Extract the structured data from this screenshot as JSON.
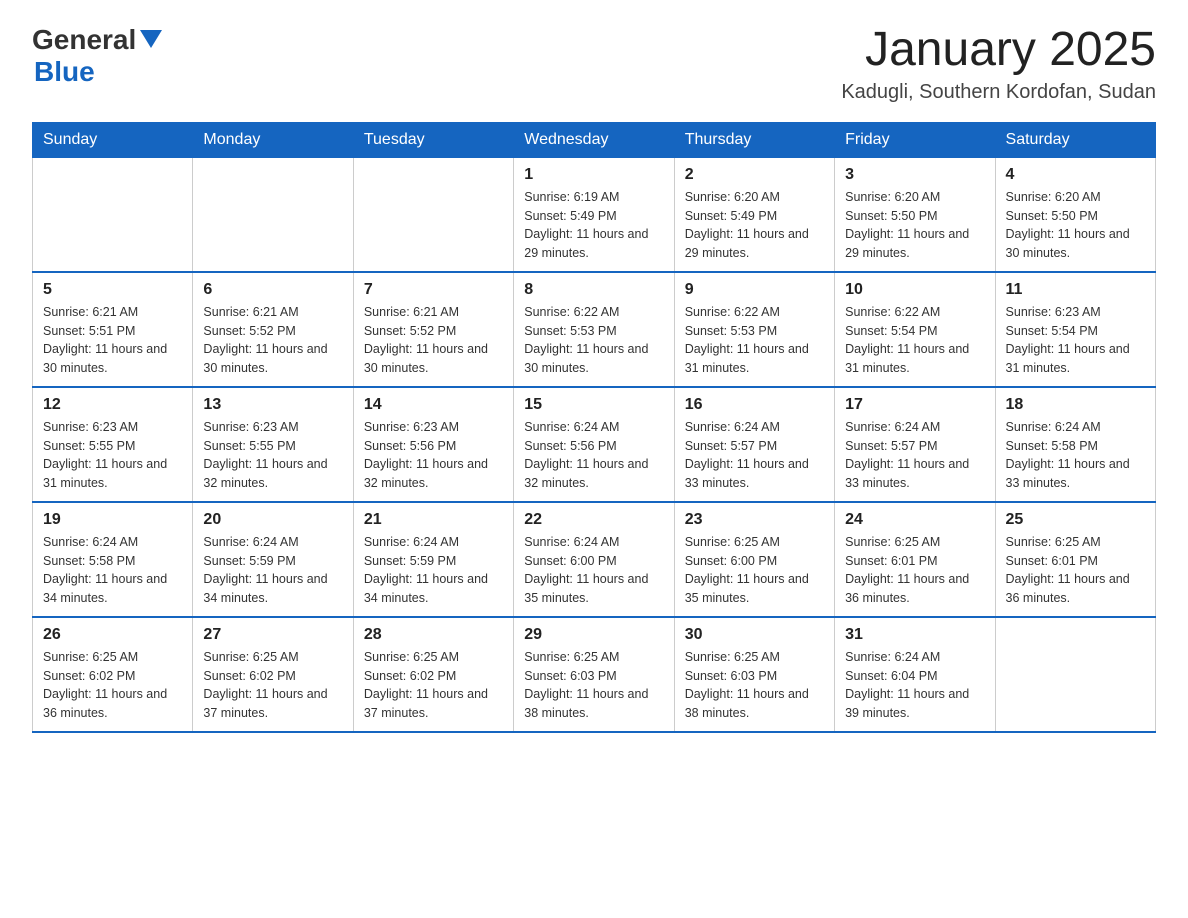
{
  "logo": {
    "general": "General",
    "blue": "Blue"
  },
  "title": "January 2025",
  "subtitle": "Kadugli, Southern Kordofan, Sudan",
  "days_of_week": [
    "Sunday",
    "Monday",
    "Tuesday",
    "Wednesday",
    "Thursday",
    "Friday",
    "Saturday"
  ],
  "weeks": [
    [
      {
        "day": "",
        "info": ""
      },
      {
        "day": "",
        "info": ""
      },
      {
        "day": "",
        "info": ""
      },
      {
        "day": "1",
        "info": "Sunrise: 6:19 AM\nSunset: 5:49 PM\nDaylight: 11 hours and 29 minutes."
      },
      {
        "day": "2",
        "info": "Sunrise: 6:20 AM\nSunset: 5:49 PM\nDaylight: 11 hours and 29 minutes."
      },
      {
        "day": "3",
        "info": "Sunrise: 6:20 AM\nSunset: 5:50 PM\nDaylight: 11 hours and 29 minutes."
      },
      {
        "day": "4",
        "info": "Sunrise: 6:20 AM\nSunset: 5:50 PM\nDaylight: 11 hours and 30 minutes."
      }
    ],
    [
      {
        "day": "5",
        "info": "Sunrise: 6:21 AM\nSunset: 5:51 PM\nDaylight: 11 hours and 30 minutes."
      },
      {
        "day": "6",
        "info": "Sunrise: 6:21 AM\nSunset: 5:52 PM\nDaylight: 11 hours and 30 minutes."
      },
      {
        "day": "7",
        "info": "Sunrise: 6:21 AM\nSunset: 5:52 PM\nDaylight: 11 hours and 30 minutes."
      },
      {
        "day": "8",
        "info": "Sunrise: 6:22 AM\nSunset: 5:53 PM\nDaylight: 11 hours and 30 minutes."
      },
      {
        "day": "9",
        "info": "Sunrise: 6:22 AM\nSunset: 5:53 PM\nDaylight: 11 hours and 31 minutes."
      },
      {
        "day": "10",
        "info": "Sunrise: 6:22 AM\nSunset: 5:54 PM\nDaylight: 11 hours and 31 minutes."
      },
      {
        "day": "11",
        "info": "Sunrise: 6:23 AM\nSunset: 5:54 PM\nDaylight: 11 hours and 31 minutes."
      }
    ],
    [
      {
        "day": "12",
        "info": "Sunrise: 6:23 AM\nSunset: 5:55 PM\nDaylight: 11 hours and 31 minutes."
      },
      {
        "day": "13",
        "info": "Sunrise: 6:23 AM\nSunset: 5:55 PM\nDaylight: 11 hours and 32 minutes."
      },
      {
        "day": "14",
        "info": "Sunrise: 6:23 AM\nSunset: 5:56 PM\nDaylight: 11 hours and 32 minutes."
      },
      {
        "day": "15",
        "info": "Sunrise: 6:24 AM\nSunset: 5:56 PM\nDaylight: 11 hours and 32 minutes."
      },
      {
        "day": "16",
        "info": "Sunrise: 6:24 AM\nSunset: 5:57 PM\nDaylight: 11 hours and 33 minutes."
      },
      {
        "day": "17",
        "info": "Sunrise: 6:24 AM\nSunset: 5:57 PM\nDaylight: 11 hours and 33 minutes."
      },
      {
        "day": "18",
        "info": "Sunrise: 6:24 AM\nSunset: 5:58 PM\nDaylight: 11 hours and 33 minutes."
      }
    ],
    [
      {
        "day": "19",
        "info": "Sunrise: 6:24 AM\nSunset: 5:58 PM\nDaylight: 11 hours and 34 minutes."
      },
      {
        "day": "20",
        "info": "Sunrise: 6:24 AM\nSunset: 5:59 PM\nDaylight: 11 hours and 34 minutes."
      },
      {
        "day": "21",
        "info": "Sunrise: 6:24 AM\nSunset: 5:59 PM\nDaylight: 11 hours and 34 minutes."
      },
      {
        "day": "22",
        "info": "Sunrise: 6:24 AM\nSunset: 6:00 PM\nDaylight: 11 hours and 35 minutes."
      },
      {
        "day": "23",
        "info": "Sunrise: 6:25 AM\nSunset: 6:00 PM\nDaylight: 11 hours and 35 minutes."
      },
      {
        "day": "24",
        "info": "Sunrise: 6:25 AM\nSunset: 6:01 PM\nDaylight: 11 hours and 36 minutes."
      },
      {
        "day": "25",
        "info": "Sunrise: 6:25 AM\nSunset: 6:01 PM\nDaylight: 11 hours and 36 minutes."
      }
    ],
    [
      {
        "day": "26",
        "info": "Sunrise: 6:25 AM\nSunset: 6:02 PM\nDaylight: 11 hours and 36 minutes."
      },
      {
        "day": "27",
        "info": "Sunrise: 6:25 AM\nSunset: 6:02 PM\nDaylight: 11 hours and 37 minutes."
      },
      {
        "day": "28",
        "info": "Sunrise: 6:25 AM\nSunset: 6:02 PM\nDaylight: 11 hours and 37 minutes."
      },
      {
        "day": "29",
        "info": "Sunrise: 6:25 AM\nSunset: 6:03 PM\nDaylight: 11 hours and 38 minutes."
      },
      {
        "day": "30",
        "info": "Sunrise: 6:25 AM\nSunset: 6:03 PM\nDaylight: 11 hours and 38 minutes."
      },
      {
        "day": "31",
        "info": "Sunrise: 6:24 AM\nSunset: 6:04 PM\nDaylight: 11 hours and 39 minutes."
      },
      {
        "day": "",
        "info": ""
      }
    ]
  ]
}
